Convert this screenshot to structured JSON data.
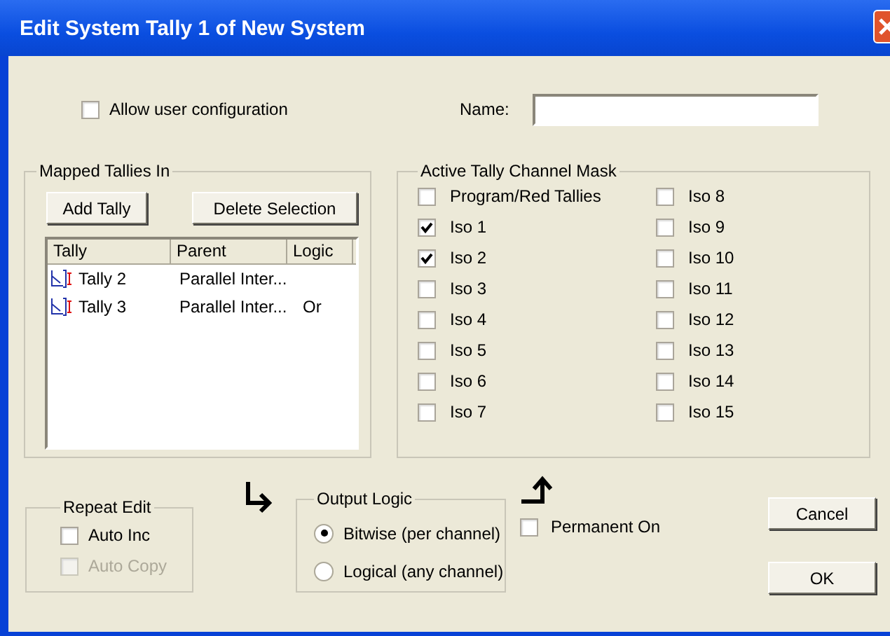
{
  "window": {
    "title": "Edit System Tally 1 of New System"
  },
  "allow_user_configuration": {
    "label": "Allow user configuration",
    "checked": false
  },
  "name_field": {
    "label": "Name:"
  },
  "mapped_tallies": {
    "title": "Mapped Tallies In",
    "buttons": [
      "Add Tally",
      "Delete Selection"
    ],
    "columns": [
      "Tally",
      "Parent",
      "Logic"
    ],
    "rows": [
      {
        "tally": "Tally 2",
        "parent": "Parallel Inter..."
      },
      {
        "tally": "Tally 3",
        "parent": "Parallel Inter...",
        "logic": "Or"
      }
    ]
  },
  "channel_mask": {
    "title": "Active Tally Channel Mask",
    "items": [
      {
        "label": "Program/Red Tallies",
        "checked": false
      },
      {
        "label": "Iso 1",
        "checked": true
      },
      {
        "label": "Iso 2",
        "checked": true
      },
      {
        "label": "Iso 3",
        "checked": false
      },
      {
        "label": "Iso 4",
        "checked": false
      },
      {
        "label": "Iso 5",
        "checked": false
      },
      {
        "label": "Iso 6",
        "checked": false
      },
      {
        "label": "Iso 7",
        "checked": false
      },
      {
        "label": "Iso 8",
        "checked": false
      },
      {
        "label": "Iso 9",
        "checked": false
      },
      {
        "label": "Iso 10",
        "checked": false
      },
      {
        "label": "Iso 11",
        "checked": false
      },
      {
        "label": "Iso 12",
        "checked": false
      },
      {
        "label": "Iso 13",
        "checked": false
      },
      {
        "label": "Iso 14",
        "checked": false
      },
      {
        "label": "Iso 15",
        "checked": false
      }
    ]
  },
  "repeat_edit": {
    "title": "Repeat Edit",
    "options": [
      {
        "label": "Auto Inc",
        "checked": false,
        "disabled": false
      },
      {
        "label": "Auto Copy",
        "checked": false,
        "disabled": true
      }
    ]
  },
  "output_logic": {
    "title": "Output Logic",
    "options": [
      {
        "label": "Bitwise (per channel)",
        "selected": true
      },
      {
        "label": "Logical (any channel)",
        "selected": false
      }
    ]
  },
  "permanent_on": {
    "label": "Permanent On",
    "checked": false
  },
  "buttons": [
    "Cancel",
    "OK"
  ]
}
